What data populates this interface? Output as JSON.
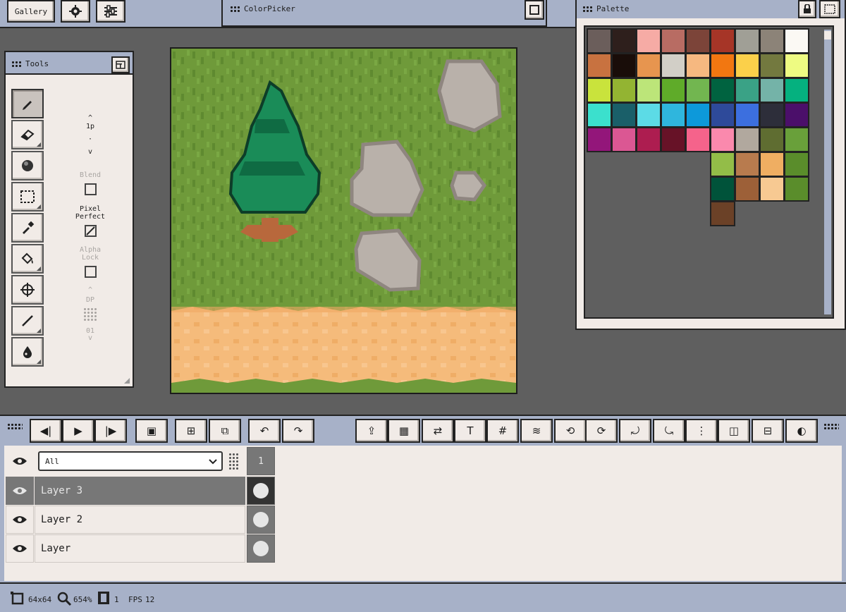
{
  "topbar": {
    "gallery_label": "Gallery",
    "settings_icon": "gear-icon",
    "options_icon": "sliders-icon"
  },
  "colorpicker": {
    "title": "ColorPicker"
  },
  "palette": {
    "title": "Palette",
    "rows": [
      [
        "#6b5e5b",
        "#2e1f1c",
        "#f6aba5",
        "#b86c63",
        "#7c4439",
        "#a63527",
        "#a09f96",
        "#8c8378",
        "#fbf9f4"
      ],
      [
        "#c87240",
        "#190d09",
        "#e7954f",
        "#d2cfc7",
        "#f6b880",
        "#f27711",
        "#fbd04a",
        "#73793f",
        "#eefb82"
      ],
      [
        "#c9e33c",
        "#93b432",
        "#bce579",
        "#5fab29",
        "#72b650",
        "#006340",
        "#3aa286",
        "#74b3a8",
        "#05b17f"
      ],
      [
        "#3be0cd",
        "#1a5f69",
        "#5cdbe6",
        "#2fb6dd",
        "#0d99da",
        "#2e4a9a",
        "#3c6fdf",
        "#2d2e3a",
        "#4b0f6a"
      ],
      [
        "#93167a",
        "#db5793",
        "#ad1d50",
        "#671227",
        "#f5638b",
        "#fa89ad",
        "#b1a89e",
        "#5f6d31",
        "#69a03a"
      ],
      [
        null,
        null,
        null,
        null,
        null,
        "#93bd48",
        "#b87b4e",
        "#efae62",
        "#5a8d2b"
      ],
      [
        null,
        null,
        null,
        null,
        null,
        "#00533a",
        "#9d6038",
        "#f7c992",
        "#5a8d2b"
      ],
      [
        null,
        null,
        null,
        null,
        null,
        "#6b4127",
        null,
        null,
        null
      ]
    ]
  },
  "tools": {
    "title": "Tools",
    "buttons": [
      "pencil-icon",
      "eraser-icon",
      "shading-ball-icon",
      "selection-rect-icon",
      "eyedropper-icon",
      "fill-bucket-icon",
      "move-icon",
      "line-icon",
      "ink-drop-icon"
    ],
    "brush_size": "1p",
    "blend_label": "Blend",
    "pixel_perfect_label": "Pixel\nPerfect",
    "alpha_lock_label": "Alpha\nLock",
    "dp_label": "DP",
    "dp_value": "01"
  },
  "toolbar": {
    "buttons": [
      "prev-frame-icon",
      "play-icon",
      "next-frame-icon",
      "save-frame-icon",
      "add-frame-icon",
      "duplicate-frame-icon",
      "undo-icon",
      "redo-icon",
      "export-icon",
      "select-all-icon",
      "flip-icon",
      "text-icon",
      "grid-icon",
      "layers-icon",
      "rotate-h-icon",
      "rotate-v-icon",
      "rotate-cw-icon",
      "rotate-ccw-icon",
      "mirror-icon",
      "flip-h-icon",
      "flip-v-icon",
      "contrast-icon"
    ]
  },
  "layers": {
    "filter_value": "All",
    "frame_number": "1",
    "items": [
      {
        "name": "Layer 3",
        "selected": true
      },
      {
        "name": "Layer 2",
        "selected": false
      },
      {
        "name": "Layer",
        "selected": false
      }
    ]
  },
  "status": {
    "canvas_size": "64x64",
    "zoom": "654%",
    "frames": "1",
    "fps_label": "FPS",
    "fps_value": "12"
  }
}
